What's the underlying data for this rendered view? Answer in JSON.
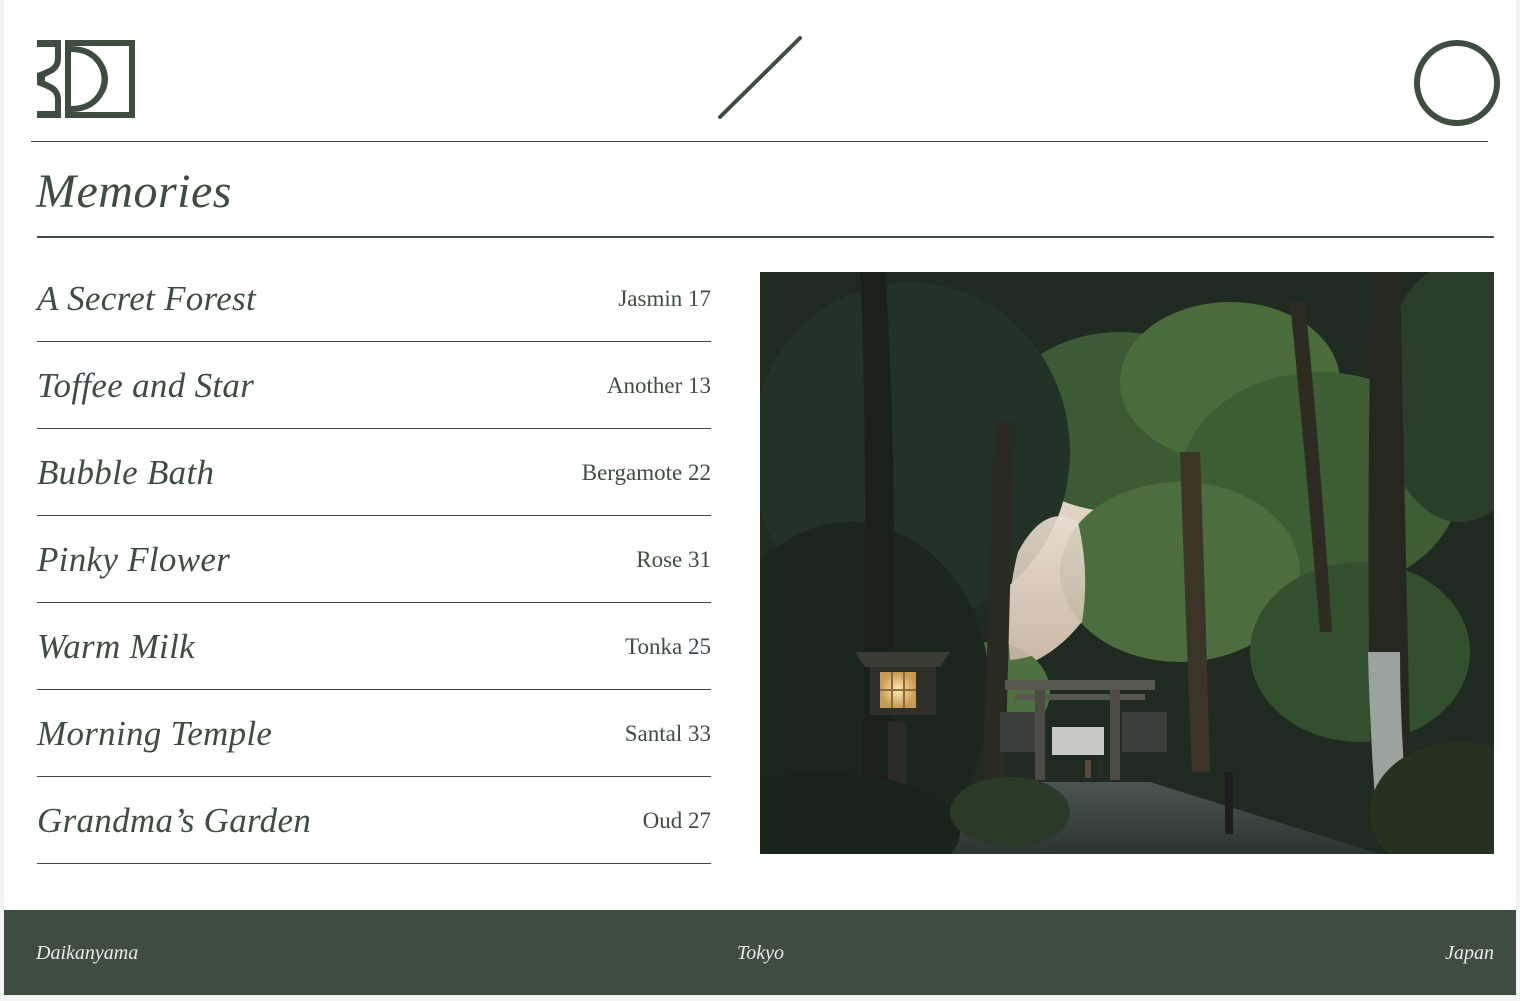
{
  "header": {
    "logo_icon": "ko-monogram-logo",
    "divider_icon": "slash-icon",
    "menu_icon": "circle-icon"
  },
  "page": {
    "title": "Memories"
  },
  "memories": [
    {
      "name": "A Secret Forest",
      "note": "Jasmin 17"
    },
    {
      "name": "Toffee and Star",
      "note": "Another 13"
    },
    {
      "name": "Bubble Bath",
      "note": "Bergamote 22"
    },
    {
      "name": "Pinky Flower",
      "note": "Rose 31"
    },
    {
      "name": "Warm Milk",
      "note": "Tonka 25"
    },
    {
      "name": "Morning Temple",
      "note": "Santal 33"
    },
    {
      "name": "Grandma’s Garden",
      "note": "Oud 27"
    }
  ],
  "photo": {
    "subject": "forest-shrine-path-photo"
  },
  "footer": {
    "left": "Daikanyama",
    "center": "Tokyo",
    "right": "Japan"
  },
  "colors": {
    "accent": "#3f4d41",
    "background": "#ffffff",
    "footer_text": "#e8ece6"
  }
}
